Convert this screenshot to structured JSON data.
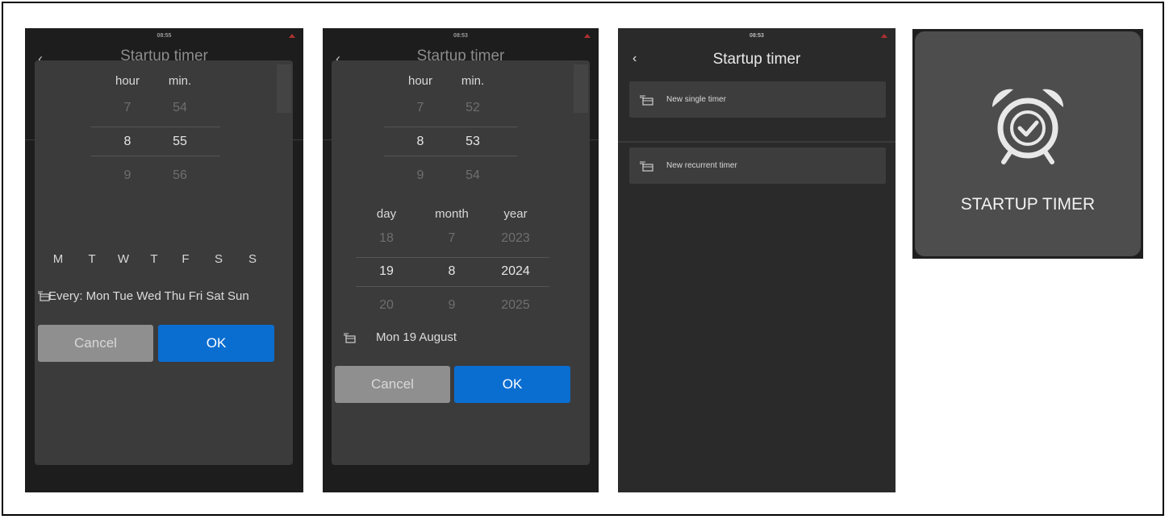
{
  "screen1": {
    "status_time": "08:55",
    "title": "Startup timer",
    "columns": {
      "hour": "hour",
      "min": "min."
    },
    "hour_values": [
      "7",
      "8",
      "9"
    ],
    "min_values": [
      "54",
      "55",
      "56"
    ],
    "weekdays": [
      "M",
      "T",
      "W",
      "T",
      "F",
      "S",
      "S"
    ],
    "summary": "Every: Mon Tue Wed Thu Fri Sat Sun",
    "cancel_label": "Cancel",
    "ok_label": "OK"
  },
  "screen2": {
    "status_time": "08:53",
    "title": "Startup timer",
    "columns": {
      "hour": "hour",
      "min": "min.",
      "day": "day",
      "month": "month",
      "year": "year"
    },
    "hour_values": [
      "7",
      "8",
      "9"
    ],
    "min_values": [
      "52",
      "53",
      "54"
    ],
    "day_values": [
      "18",
      "19",
      "20"
    ],
    "month_values": [
      "7",
      "8",
      "9"
    ],
    "year_values": [
      "2023",
      "2024",
      "2025"
    ],
    "summary": "Mon 19 August",
    "cancel_label": "Cancel",
    "ok_label": "OK"
  },
  "screen3": {
    "status_time": "08:53",
    "title": "Startup timer",
    "items": [
      {
        "label": "New single timer"
      },
      {
        "label": "New recurrent timer"
      }
    ]
  },
  "tile": {
    "label": "STARTUP TIMER",
    "icon": "alarm-clock-check-icon"
  },
  "colors": {
    "ok_button": "#0a6ed1",
    "cancel_button": "#8f8f8f",
    "dialog": "#3b3b3b",
    "screen_bg": "#1d1d1d",
    "tile_bg": "#4d4d4d"
  }
}
